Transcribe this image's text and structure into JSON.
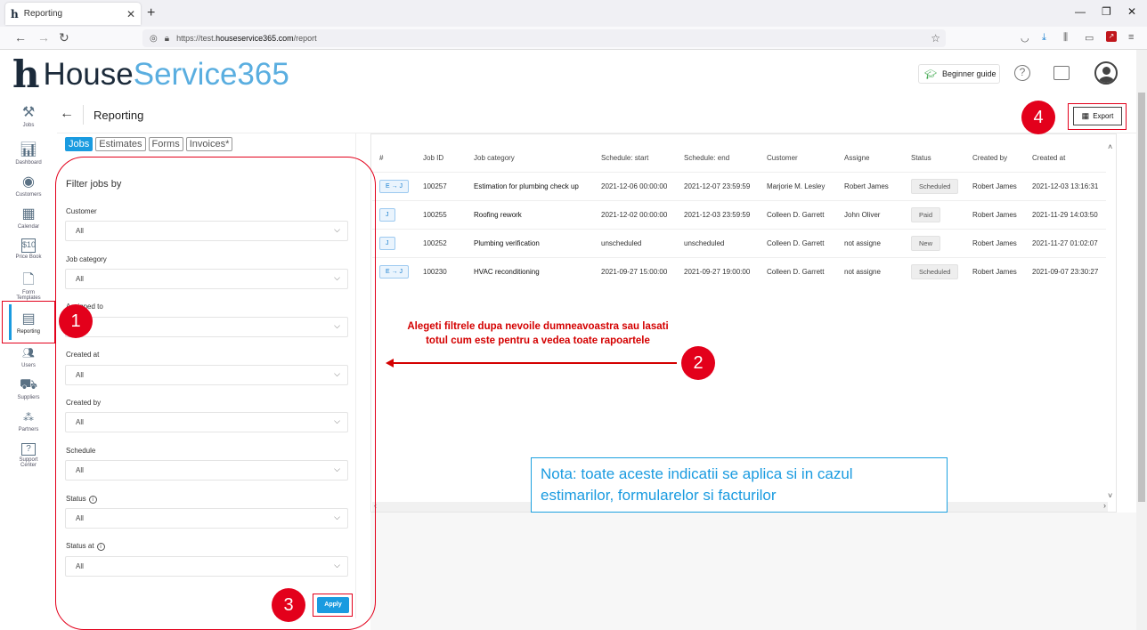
{
  "browser": {
    "tab_title": "Reporting",
    "tab_favicon": "h",
    "url_prefix": "https://test.",
    "url_domain": "houseservice365.com",
    "url_path": "/report"
  },
  "header": {
    "logo_h": "h",
    "logo_word1": "House",
    "logo_word2": "Service365",
    "beginner_guide": "Beginner guide",
    "help_glyph": "?"
  },
  "sidebar": {
    "items": [
      {
        "label": "Jobs",
        "icon": "tools-icon"
      },
      {
        "label": "Dashboard",
        "icon": "chart-icon"
      },
      {
        "label": "Customers",
        "icon": "customers-icon"
      },
      {
        "label": "Calendar",
        "icon": "calendar-icon"
      },
      {
        "label": "Price Book",
        "icon": "pricebook-icon"
      },
      {
        "label": "Form Templates",
        "icon": "form-icon"
      },
      {
        "label": "Reporting",
        "icon": "reporting-icon"
      },
      {
        "label": "Users",
        "icon": "users-icon"
      },
      {
        "label": "Suppliers",
        "icon": "truck-icon"
      },
      {
        "label": "Partners",
        "icon": "partners-icon"
      },
      {
        "label": "Support Center",
        "icon": "support-icon"
      }
    ]
  },
  "page": {
    "title": "Reporting",
    "export_label": "Export"
  },
  "filter": {
    "tabs": [
      "Jobs",
      "Estimates",
      "Forms",
      "Invoices*"
    ],
    "title": "Filter jobs by",
    "fields": [
      {
        "label": "Customer",
        "value": "All"
      },
      {
        "label": "Job category",
        "value": "All"
      },
      {
        "label": "Assigned to",
        "value": ""
      },
      {
        "label": "Created at",
        "value": "All"
      },
      {
        "label": "Created by",
        "value": "All"
      },
      {
        "label": "Schedule",
        "value": "All"
      },
      {
        "label": "Status",
        "value": "All"
      },
      {
        "label": "Status at",
        "value": "All"
      }
    ],
    "apply_label": "Apply"
  },
  "table": {
    "columns": [
      "#",
      "Job ID",
      "Job category",
      "Schedule: start",
      "Schedule: end",
      "Customer",
      "Assigne",
      "Status",
      "Created by",
      "Created at"
    ],
    "rows": [
      {
        "type": "E → J",
        "id": "100257",
        "category": "Estimation for plumbing check up",
        "start": "2021-12-06 00:00:00",
        "end": "2021-12-07 23:59:59",
        "customer": "Marjorie M. Lesley",
        "assignee": "Robert James",
        "status": "Scheduled",
        "created_by": "Robert James",
        "created_at": "2021-12-03 13:16:31"
      },
      {
        "type": "J",
        "id": "100255",
        "category": "Roofing rework",
        "start": "2021-12-02 00:00:00",
        "end": "2021-12-03 23:59:59",
        "customer": "Colleen D. Garrett",
        "assignee": "John Oliver",
        "status": "Paid",
        "created_by": "Robert James",
        "created_at": "2021-11-29 14:03:50"
      },
      {
        "type": "J",
        "id": "100252",
        "category": "Plumbing verification",
        "start": "unscheduled",
        "end": "unscheduled",
        "customer": "Colleen D. Garrett",
        "assignee": "not assigne",
        "status": "New",
        "created_by": "Robert James",
        "created_at": "2021-11-27 01:02:07"
      },
      {
        "type": "E → J",
        "id": "100230",
        "category": "HVAC reconditioning",
        "start": "2021-09-27 15:00:00",
        "end": "2021-09-27 19:00:00",
        "customer": "Colleen D. Garrett",
        "assignee": "not assigne",
        "status": "Scheduled",
        "created_by": "Robert James",
        "created_at": "2021-09-07 23:30:27"
      }
    ]
  },
  "annotations": {
    "n1": "1",
    "n2": "2",
    "n3": "3",
    "n4": "4",
    "hint_line1": "Alegeti filtrele dupa nevoile dumneavoastra sau lasati",
    "hint_line2": "totul cum este pentru a vedea toate rapoartele",
    "nota_line1": "Nota: toate aceste indicatii se aplica si in cazul",
    "nota_line2": "estimarilor, formularelor  si facturilor",
    "accent_color": "#e3001b",
    "nota_color": "#1a9be0"
  }
}
